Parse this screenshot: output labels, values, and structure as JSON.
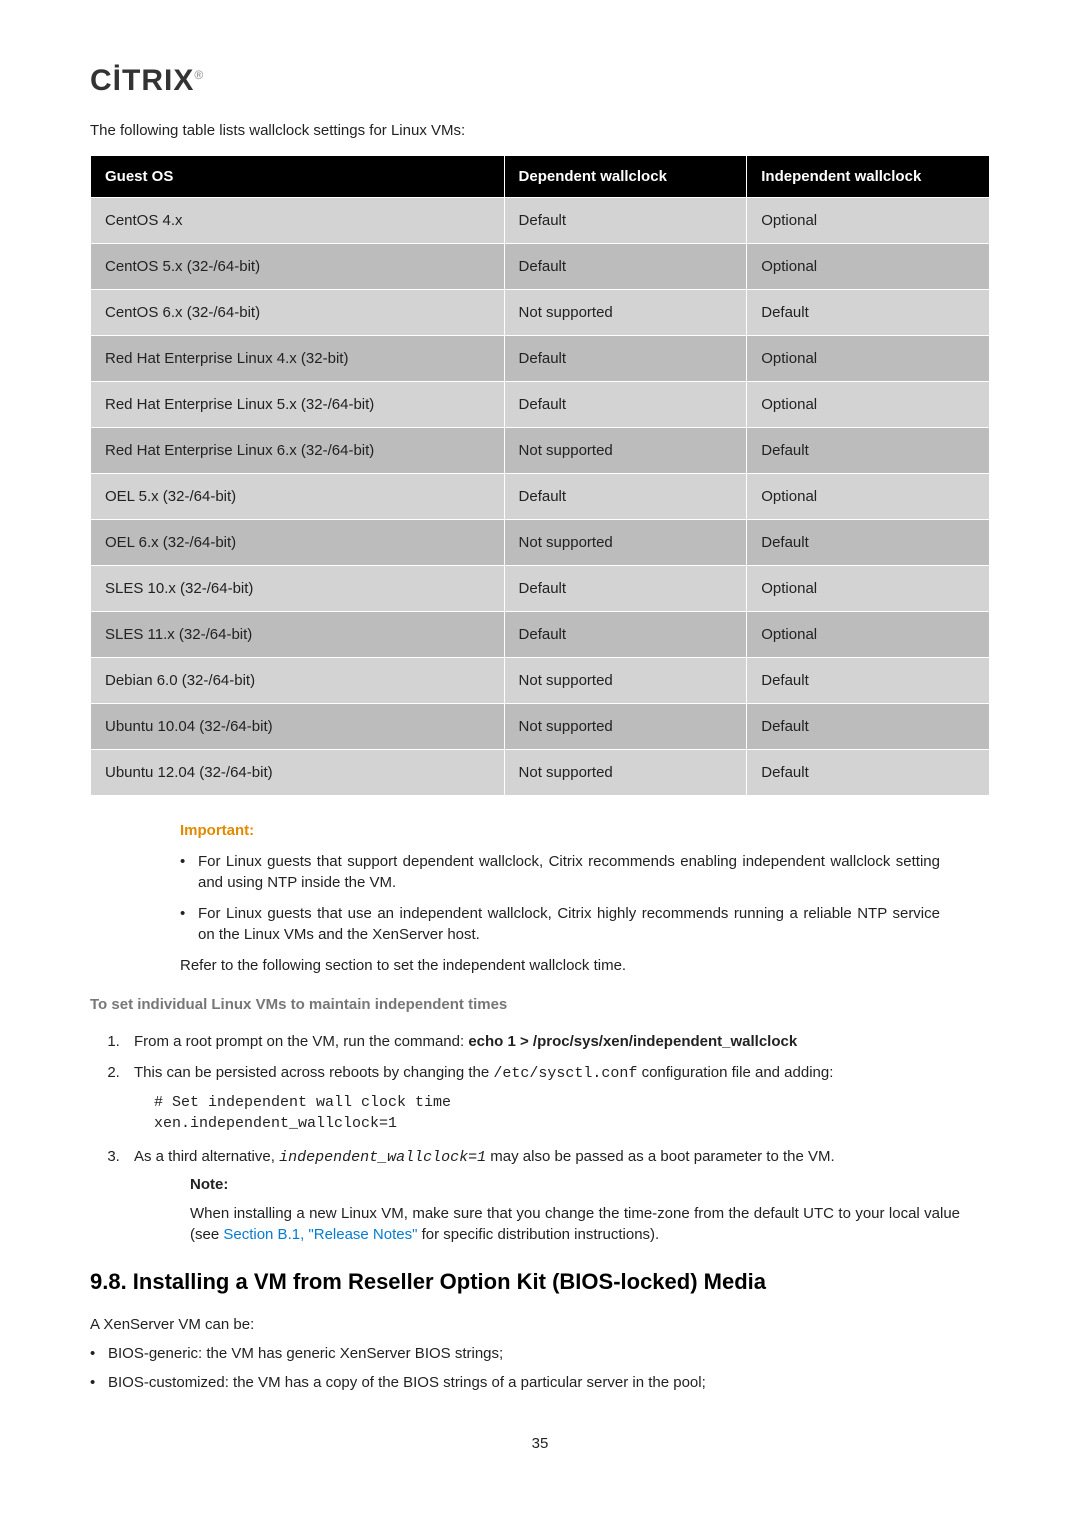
{
  "logo": {
    "text": "CİTRIX",
    "reg": "®"
  },
  "intro": "The following table lists wallclock settings for Linux VMs:",
  "table": {
    "headers": {
      "os": "Guest OS",
      "dep": "Dependent wallclock",
      "ind": "Independent wallclock"
    },
    "rows": [
      {
        "os": "CentOS 4.x",
        "dep": "Default",
        "ind": "Optional"
      },
      {
        "os": "CentOS 5.x (32-/64-bit)",
        "dep": "Default",
        "ind": "Optional"
      },
      {
        "os": "CentOS 6.x (32-/64-bit)",
        "dep": "Not supported",
        "ind": "Default"
      },
      {
        "os": "Red Hat Enterprise Linux 4.x (32-bit)",
        "dep": "Default",
        "ind": "Optional"
      },
      {
        "os": "Red Hat Enterprise Linux 5.x (32-/64-bit)",
        "dep": "Default",
        "ind": "Optional"
      },
      {
        "os": "Red Hat Enterprise Linux 6.x (32-/64-bit)",
        "dep": "Not supported",
        "ind": "Default"
      },
      {
        "os": "OEL 5.x (32-/64-bit)",
        "dep": "Default",
        "ind": "Optional"
      },
      {
        "os": "OEL 6.x (32-/64-bit)",
        "dep": "Not supported",
        "ind": "Default"
      },
      {
        "os": "SLES 10.x (32-/64-bit)",
        "dep": "Default",
        "ind": "Optional"
      },
      {
        "os": "SLES 11.x (32-/64-bit)",
        "dep": "Default",
        "ind": "Optional"
      },
      {
        "os": "Debian 6.0 (32-/64-bit)",
        "dep": "Not supported",
        "ind": "Default"
      },
      {
        "os": "Ubuntu 10.04 (32-/64-bit)",
        "dep": "Not supported",
        "ind": "Default"
      },
      {
        "os": "Ubuntu 12.04 (32-/64-bit)",
        "dep": "Not supported",
        "ind": "Default"
      }
    ]
  },
  "important": {
    "label": "Important:",
    "items": [
      "For Linux guests that support dependent wallclock, Citrix recommends enabling independent wallclock setting and using NTP inside the VM.",
      "For Linux guests that use an independent wallclock, Citrix highly recommends running a reliable NTP service on the Linux VMs and the XenServer host."
    ],
    "refer": "Refer to the following section to set the independent wallclock time."
  },
  "subhead": "To set individual Linux VMs to maintain independent times",
  "steps": {
    "s1_pre": "From a root prompt on the VM, run the command: ",
    "s1_cmd": "echo 1 > /proc/sys/xen/independent_wallclock",
    "s2_pre": "This can be persisted across reboots by changing the ",
    "s2_file": "/etc/sysctl.conf",
    "s2_post": " configuration file and adding:",
    "s2_code": "# Set independent wall clock time\nxen.independent_wallclock=1",
    "s3_pre": "As a third alternative, ",
    "s3_param": "independent_wallclock=1",
    "s3_post": " may also be passed as a boot parameter to the VM."
  },
  "note": {
    "label": "Note:",
    "text_pre": "When installing a new Linux VM, make sure that you change the time-zone from the default UTC to your local value (see ",
    "link": "Section B.1, \"Release Notes\"",
    "text_post": " for specific distribution instructions)."
  },
  "section_title": "9.8. Installing a VM from Reseller Option Kit (BIOS-locked) Media",
  "body": {
    "intro": "A XenServer VM can be:",
    "items": [
      "BIOS-generic: the VM has generic XenServer BIOS strings;",
      "BIOS-customized: the VM has a copy of the BIOS strings of a particular server in the pool;"
    ]
  },
  "page": "35"
}
